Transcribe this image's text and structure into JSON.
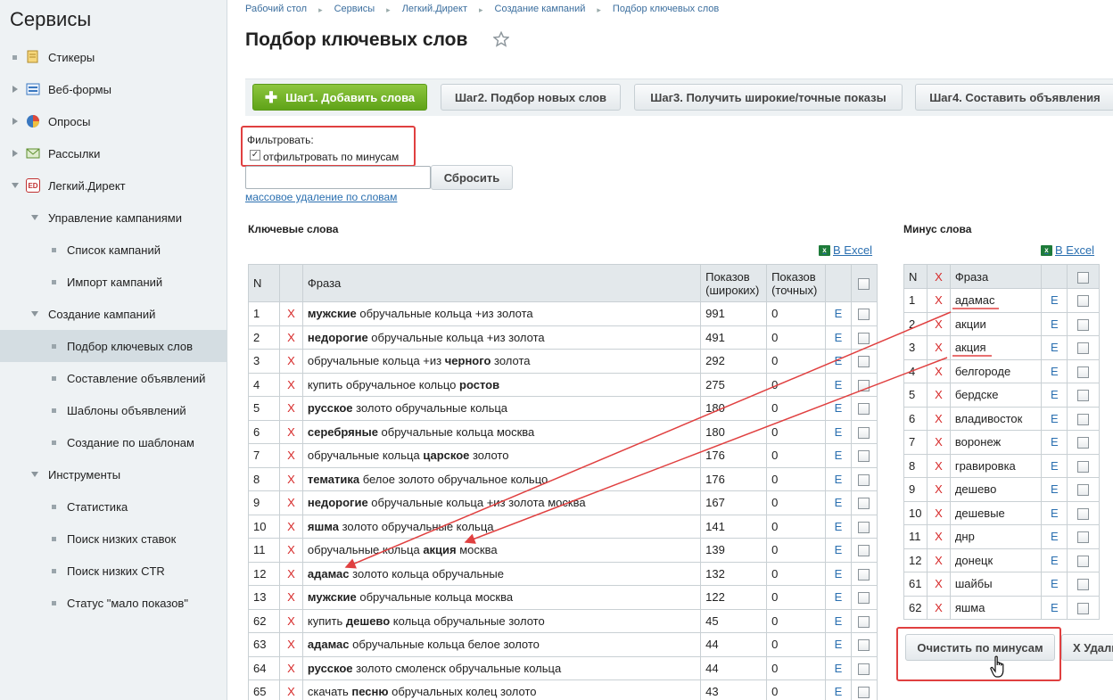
{
  "sidebar": {
    "title": "Сервисы",
    "items": [
      {
        "label": "Стикеры",
        "marker": "bullet",
        "icon": "sticker-icon"
      },
      {
        "label": "Веб-формы",
        "marker": "tri-right",
        "icon": "form-icon"
      },
      {
        "label": "Опросы",
        "marker": "tri-right",
        "icon": "poll-icon"
      },
      {
        "label": "Рассылки",
        "marker": "tri-right",
        "icon": "mail-icon"
      },
      {
        "label": "Легкий.Директ",
        "marker": "tri-down",
        "icon": "ed-icon",
        "icon_text": "ED"
      },
      {
        "label": "Управление кампаниями",
        "marker": "tri-down"
      },
      {
        "label": "Список кампаний",
        "marker": "bullet"
      },
      {
        "label": "Импорт кампаний",
        "marker": "bullet"
      },
      {
        "label": "Создание кампаний",
        "marker": "tri-down"
      },
      {
        "label": "Подбор ключевых слов",
        "marker": "bullet",
        "active": true
      },
      {
        "label": "Составление объявлений",
        "marker": "bullet"
      },
      {
        "label": "Шаблоны объявлений",
        "marker": "bullet"
      },
      {
        "label": "Создание по шаблонам",
        "marker": "bullet"
      },
      {
        "label": "Инструменты",
        "marker": "tri-down"
      },
      {
        "label": "Статистика",
        "marker": "bullet"
      },
      {
        "label": "Поиск низких ставок",
        "marker": "bullet"
      },
      {
        "label": "Поиск низких CTR",
        "marker": "bullet"
      },
      {
        "label": "Статус \"мало показов\"",
        "marker": "bullet"
      }
    ]
  },
  "breadcrumb": [
    "Рабочий стол",
    "Сервисы",
    "Легкий.Директ",
    "Создание кампаний",
    "Подбор ключевых слов"
  ],
  "page_title": "Подбор ключевых слов",
  "tabs": [
    "Шаг1. Добавить слова",
    "Шаг2. Подбор новых слов",
    "Шаг3. Получить широкие/точные показы",
    "Шаг4. Составить объявления"
  ],
  "filter": {
    "label": "Фильтровать:",
    "checkbox_label": "отфильтровать по минусам",
    "checked_glyph": "✓",
    "input_value": "",
    "reset_label": "Сбросить",
    "mass_delete_link": "массовое удаление по словам"
  },
  "keywords": {
    "title": "Ключевые слова",
    "excel_link": "В Excel",
    "columns": {
      "n": "N",
      "x": "X",
      "phrase": "Фраза",
      "wide_1": "Показов",
      "wide_2": "(широких)",
      "exact_1": "Показов",
      "exact_2": "(точных)"
    },
    "rows": [
      {
        "n": "1",
        "x": "X",
        "bold": "мужские",
        "rest": " обручальные кольца +из золота",
        "pre": "",
        "wide": "991",
        "exact": "0",
        "e": "E"
      },
      {
        "n": "2",
        "x": "X",
        "bold": "недорогие",
        "rest": " обручальные кольца +из золота",
        "pre": "",
        "wide": "491",
        "exact": "0",
        "e": "E"
      },
      {
        "n": "3",
        "x": "X",
        "pre": "обручальные кольца +из ",
        "bold": "черного",
        "rest": " золота",
        "wide": "292",
        "exact": "0",
        "e": "E"
      },
      {
        "n": "4",
        "x": "X",
        "pre": "купить обручальное кольцо ",
        "bold": "ростов",
        "rest": "",
        "wide": "275",
        "exact": "0",
        "e": "E"
      },
      {
        "n": "5",
        "x": "X",
        "pre": "",
        "bold": "русское",
        "rest": " золото обручальные кольца",
        "wide": "180",
        "exact": "0",
        "e": "E"
      },
      {
        "n": "6",
        "x": "X",
        "pre": "",
        "bold": "серебряные",
        "rest": " обручальные кольца москва",
        "wide": "180",
        "exact": "0",
        "e": "E"
      },
      {
        "n": "7",
        "x": "X",
        "pre": "обручальные кольца ",
        "bold": "царское",
        "rest": " золото",
        "wide": "176",
        "exact": "0",
        "e": "E"
      },
      {
        "n": "8",
        "x": "X",
        "pre": "",
        "bold": "тематика",
        "rest": " белое золото обручальное кольцо",
        "wide": "176",
        "exact": "0",
        "e": "E"
      },
      {
        "n": "9",
        "x": "X",
        "pre": "",
        "bold": "недорогие",
        "rest": " обручальные кольца +из золота москва",
        "wide": "167",
        "exact": "0",
        "e": "E"
      },
      {
        "n": "10",
        "x": "X",
        "pre": "",
        "bold": "яшма",
        "rest": " золото обручальные кольца",
        "wide": "141",
        "exact": "0",
        "e": "E"
      },
      {
        "n": "11",
        "x": "X",
        "pre": "обручальные кольца ",
        "bold": "акция",
        "rest": " москва",
        "wide": "139",
        "exact": "0",
        "e": "E"
      },
      {
        "n": "12",
        "x": "X",
        "pre": "",
        "bold": "адамас",
        "rest": " золото кольца обручальные",
        "wide": "132",
        "exact": "0",
        "e": "E"
      },
      {
        "n": "13",
        "x": "X",
        "pre": "",
        "bold": "мужские",
        "rest": " обручальные кольца москва",
        "wide": "122",
        "exact": "0",
        "e": "E"
      },
      {
        "n": "62",
        "x": "X",
        "pre": "купить ",
        "bold": "дешево",
        "rest": " кольца обручальные золото",
        "wide": "45",
        "exact": "0",
        "e": "E"
      },
      {
        "n": "63",
        "x": "X",
        "pre": "",
        "bold": "адамас",
        "rest": " обручальные кольца белое золото",
        "wide": "44",
        "exact": "0",
        "e": "E"
      },
      {
        "n": "64",
        "x": "X",
        "pre": "",
        "bold": "русское",
        "rest": " золото смоленск обручальные кольца",
        "wide": "44",
        "exact": "0",
        "e": "E"
      },
      {
        "n": "65",
        "x": "X",
        "pre": "скачать ",
        "bold": "песню",
        "rest": " обручальных колец золото",
        "wide": "43",
        "exact": "0",
        "e": "E"
      }
    ]
  },
  "minus": {
    "title": "Минус слова",
    "excel_link": "В Excel",
    "columns": {
      "n": "N",
      "x": "X",
      "phrase": "Фраза"
    },
    "rows": [
      {
        "n": "1",
        "x": "X",
        "phrase": "адамас",
        "e": "E"
      },
      {
        "n": "2",
        "x": "X",
        "phrase": "акции",
        "e": "E"
      },
      {
        "n": "3",
        "x": "X",
        "phrase": "акция",
        "e": "E"
      },
      {
        "n": "4",
        "x": "X",
        "phrase": "белгороде",
        "e": "E"
      },
      {
        "n": "5",
        "x": "X",
        "phrase": "бердске",
        "e": "E"
      },
      {
        "n": "6",
        "x": "X",
        "phrase": "владивосток",
        "e": "E"
      },
      {
        "n": "7",
        "x": "X",
        "phrase": "воронеж",
        "e": "E"
      },
      {
        "n": "8",
        "x": "X",
        "phrase": "гравировка",
        "e": "E"
      },
      {
        "n": "9",
        "x": "X",
        "phrase": "дешево",
        "e": "E"
      },
      {
        "n": "10",
        "x": "X",
        "phrase": "дешевые",
        "e": "E"
      },
      {
        "n": "11",
        "x": "X",
        "phrase": "днр",
        "e": "E"
      },
      {
        "n": "12",
        "x": "X",
        "phrase": "донецк",
        "e": "E"
      },
      {
        "n": "61",
        "x": "X",
        "phrase": "шайбы",
        "e": "E"
      },
      {
        "n": "62",
        "x": "X",
        "phrase": "яшма",
        "e": "E"
      }
    ],
    "clear_button": "Очистить по минусам",
    "delete_button": "X Удалить"
  },
  "colors": {
    "accent_green": "#6cb52a",
    "highlight_red": "#e04040",
    "link_blue": "#2a6fb0",
    "x_red": "#d62a2a"
  }
}
